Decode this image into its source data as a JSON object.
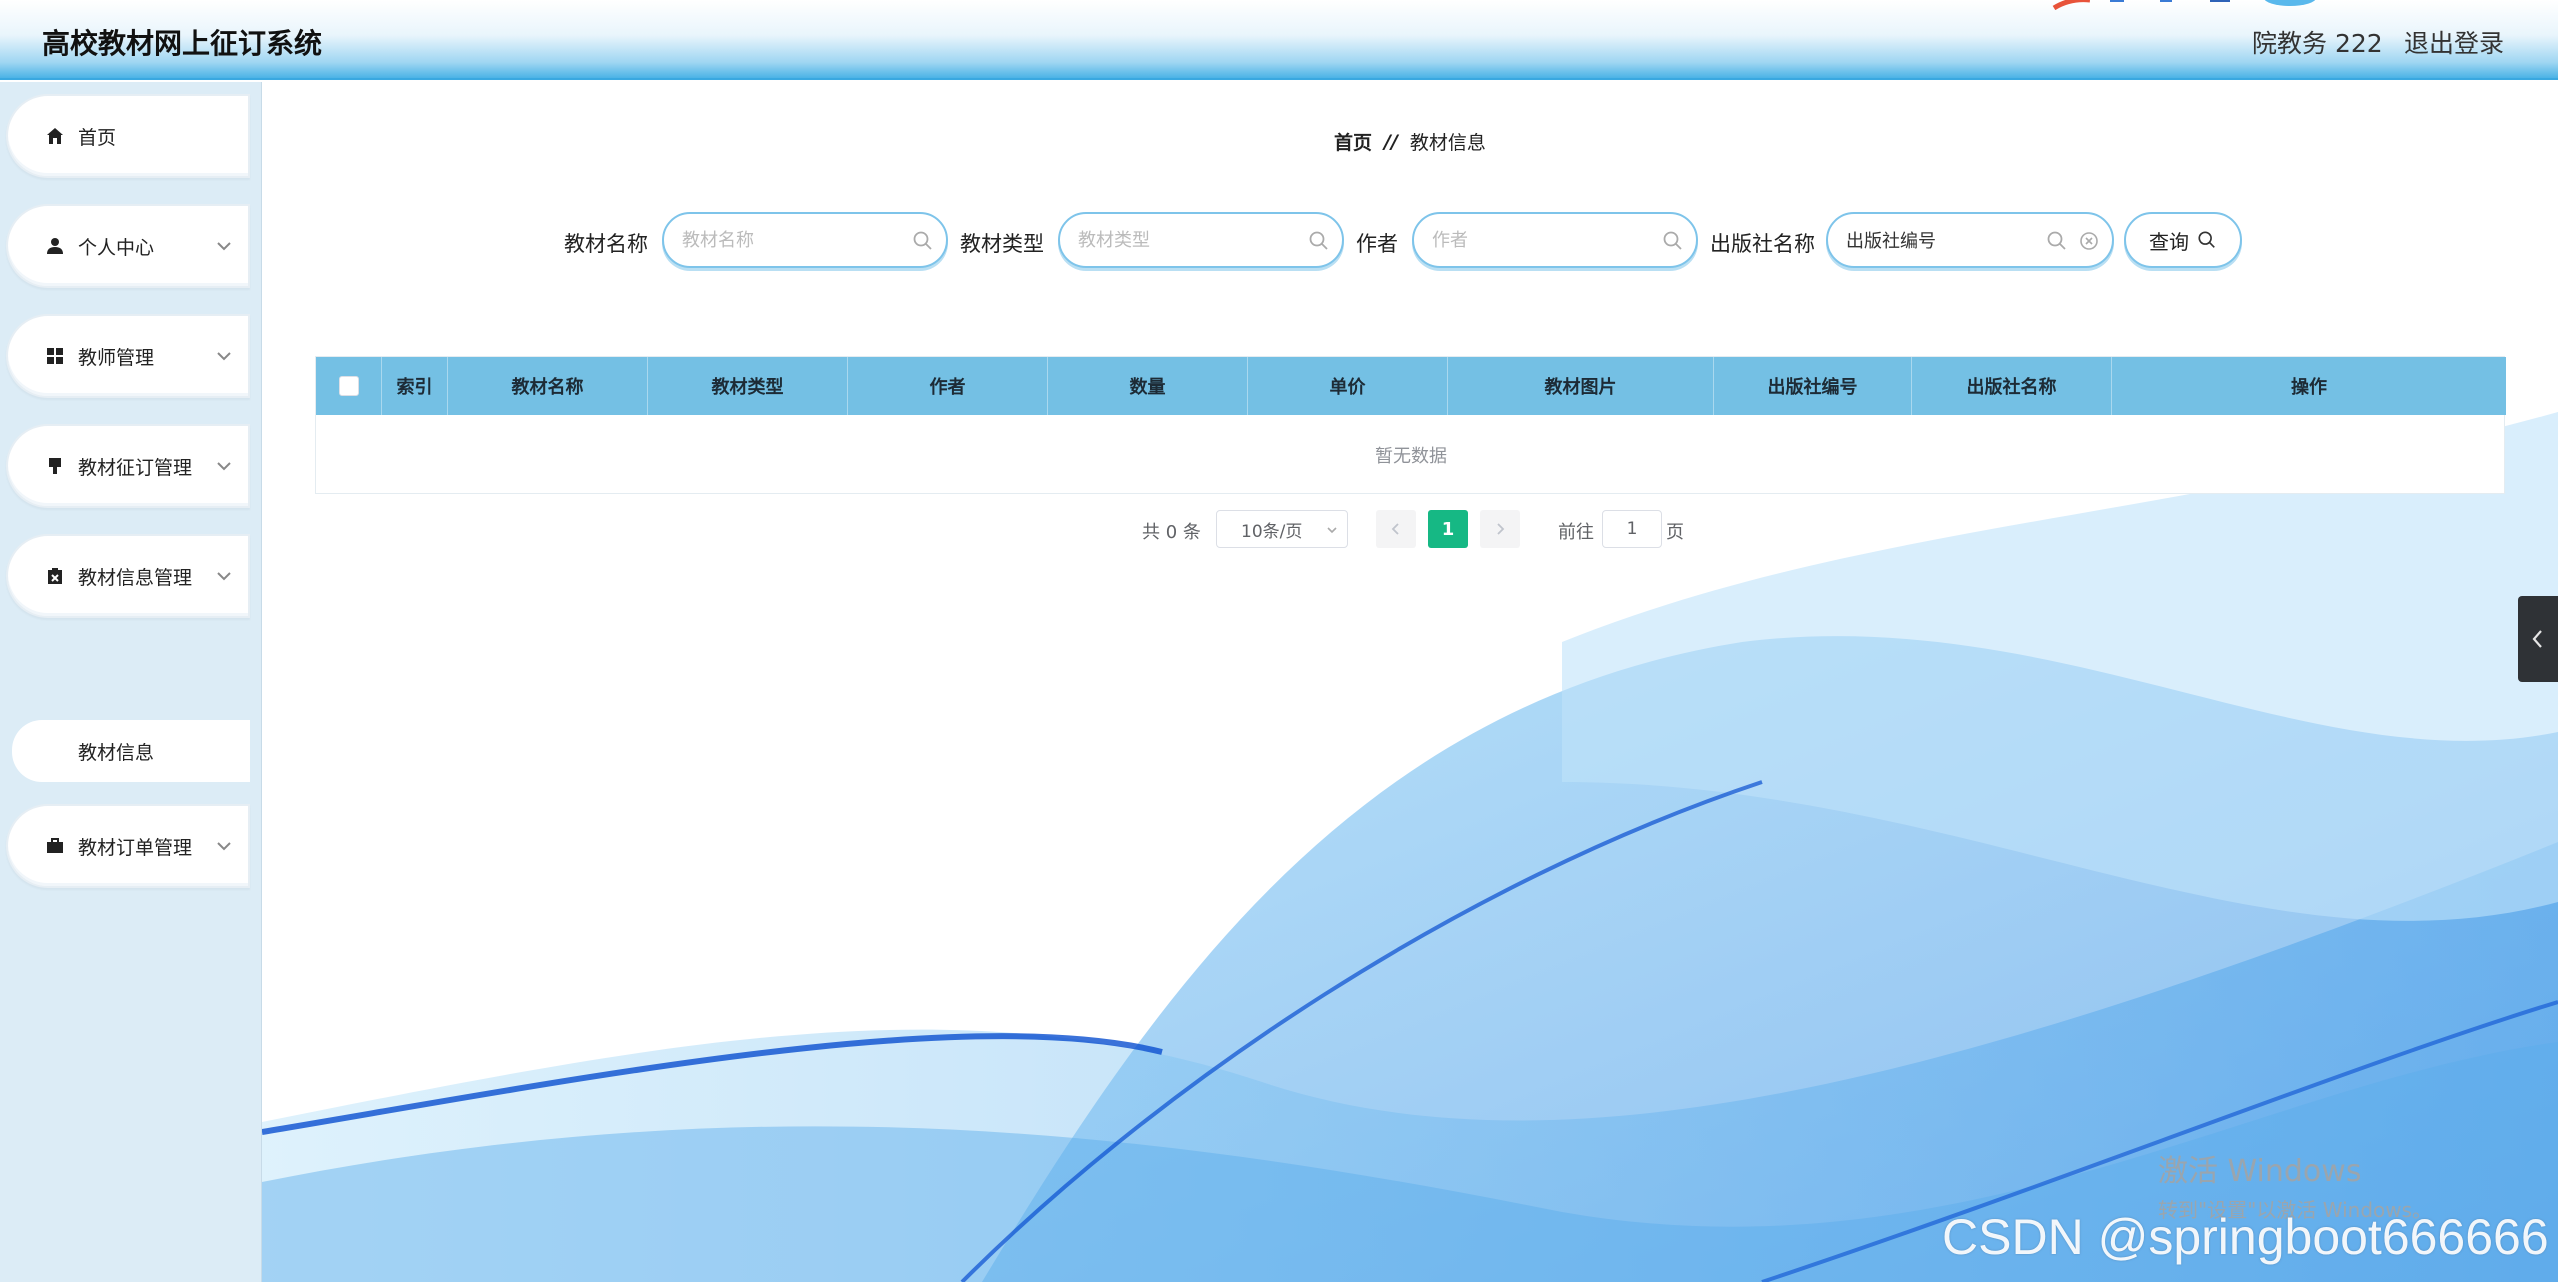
{
  "header": {
    "title": "高校教材网上征订系统",
    "user": "院教务 222",
    "logout": "退出登录"
  },
  "sidebar": {
    "items": [
      {
        "label": "首页",
        "icon": "home-icon"
      },
      {
        "label": "个人中心",
        "icon": "user-icon"
      },
      {
        "label": "教师管理",
        "icon": "grid-icon"
      },
      {
        "label": "教材征订管理",
        "icon": "pin-icon"
      },
      {
        "label": "教材信息管理",
        "icon": "clipboard-icon"
      },
      {
        "label": "教材订单管理",
        "icon": "briefcase-icon"
      }
    ],
    "sub_item": "教材信息"
  },
  "breadcrumb": {
    "home": "首页",
    "sep": "//",
    "current": "教材信息"
  },
  "search": {
    "fields": [
      {
        "label": "教材名称",
        "placeholder": "教材名称",
        "value": ""
      },
      {
        "label": "教材类型",
        "placeholder": "教材类型",
        "value": ""
      },
      {
        "label": "作者",
        "placeholder": "作者",
        "value": ""
      },
      {
        "label": "出版社名称",
        "placeholder": "出版社编号",
        "value": "出版社编号"
      }
    ],
    "button": "查询"
  },
  "table": {
    "columns": [
      "索引",
      "教材名称",
      "教材类型",
      "作者",
      "数量",
      "单价",
      "教材图片",
      "出版社编号",
      "出版社名称",
      "操作"
    ],
    "empty_text": "暂无数据"
  },
  "pagination": {
    "total": "共 0 条",
    "page_size": "10条/页",
    "current_page": "1",
    "goto_label": "前往",
    "goto_value": "1",
    "page_suffix": "页"
  },
  "overlay": {
    "activate_title": "激活 Windows",
    "activate_sub": "转到\"设置\"以激活 Windows。",
    "watermark": "CSDN @springboot666666"
  },
  "colors": {
    "header_accent": "#4cb3e6",
    "table_header": "#74c0e4",
    "page_active": "#16b884",
    "sidebar_bg": "#dcecf6"
  }
}
